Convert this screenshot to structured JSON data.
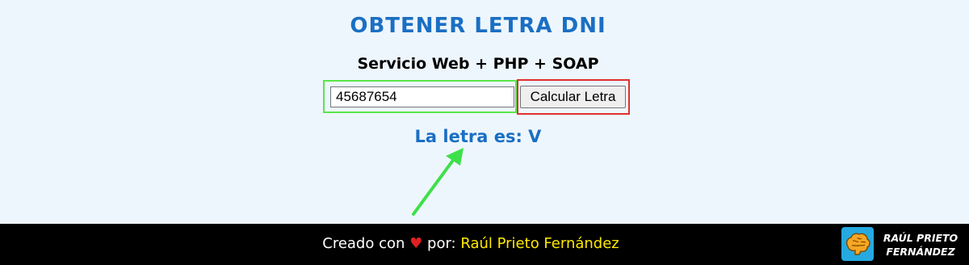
{
  "header": {
    "title": "OBTENER LETRA DNI",
    "subtitle": "Servicio Web + PHP + SOAP"
  },
  "form": {
    "dni_value": "45687654",
    "calc_button_label": "Calcular Letra"
  },
  "result": {
    "text": "La letra es: V"
  },
  "footer": {
    "created_text": "Creado con",
    "heart": "♥",
    "por_text": "por:",
    "author": "Raúl Prieto Fernández",
    "logo_line1": "RAÚL PRIETO",
    "logo_line2": "FERNÁNDEZ"
  },
  "colors": {
    "title_blue": "#1a6fc4",
    "input_highlight": "#59e64a",
    "button_highlight": "#e03030",
    "arrow_green": "#3ee04a",
    "author_yellow": "#ffea00",
    "heart_red": "#e02020",
    "logo_blue": "#26a9e0"
  }
}
